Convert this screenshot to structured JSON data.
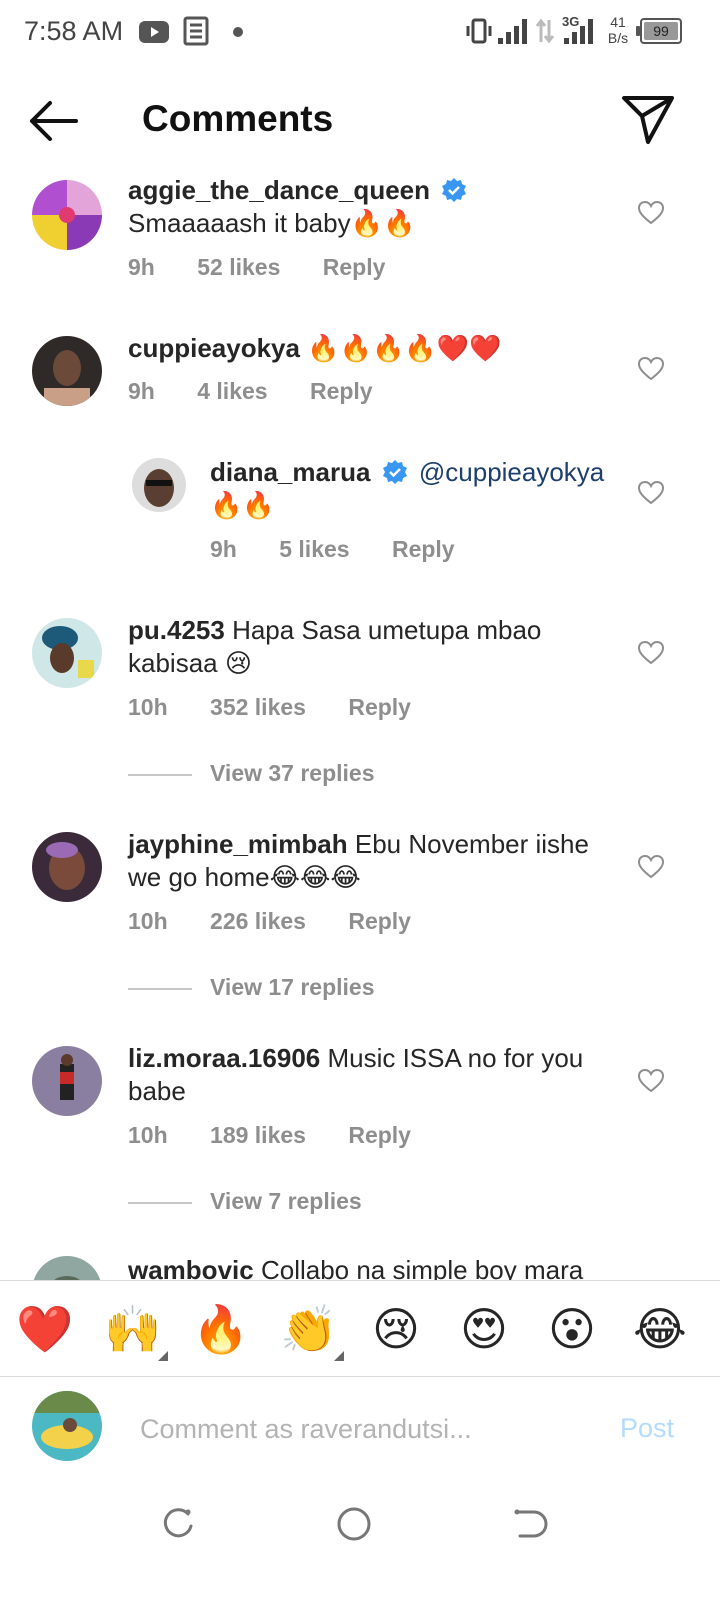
{
  "status_bar": {
    "time": "7:58 AM",
    "net_speed_value": "41",
    "net_speed_unit": "B/s",
    "network_type": "3G",
    "battery": "99",
    "icons": [
      "youtube-icon",
      "news-icon",
      "dot-icon",
      "vibrate-icon",
      "signal-icon",
      "data-arrows-icon",
      "signal-icon",
      "battery-icon"
    ]
  },
  "header": {
    "title": "Comments",
    "back_icon": "arrow-left-icon",
    "share_icon": "send-icon"
  },
  "comments": [
    {
      "username": "aggie_the_dance_queen",
      "verified": true,
      "text": "Smaaaaash it baby🔥🔥",
      "time": "9h",
      "likes": "52 likes",
      "reply": "Reply"
    },
    {
      "username": "cuppieayokya",
      "verified": false,
      "text": "🔥🔥🔥🔥❤️❤️",
      "time": "9h",
      "likes": "4 likes",
      "reply": "Reply"
    },
    {
      "username": "diana_marua",
      "verified": true,
      "mention": "@cuppieayokya",
      "text": "🔥🔥",
      "time": "9h",
      "likes": "5 likes",
      "reply": "Reply",
      "is_reply": true
    },
    {
      "username": "pu.4253",
      "verified": false,
      "text": "Hapa Sasa umetupa mbao kabisaa 😢",
      "time": "10h",
      "likes": "352 likes",
      "reply": "Reply",
      "view_replies": "View 37 replies"
    },
    {
      "username": "jayphine_mimbah",
      "verified": false,
      "text": "Ebu November iishe we go home😂😂😂",
      "time": "10h",
      "likes": "226 likes",
      "reply": "Reply",
      "view_replies": "View 17 replies"
    },
    {
      "username": "liz.moraa.16906",
      "verified": false,
      "text": "Music ISSA no for you babe",
      "time": "10h",
      "likes": "189 likes",
      "reply": "Reply",
      "view_replies": "View 7 replies"
    },
    {
      "username": "wambovic",
      "verified": false,
      "text": "Collabo na simple boy mara"
    }
  ],
  "emoji_bar": [
    "❤️",
    "🙌",
    "🔥",
    "👏",
    "😢",
    "😍",
    "😮",
    "😂"
  ],
  "compose": {
    "placeholder": "Comment as raverandutsi...",
    "post_label": "Post"
  },
  "colors": {
    "accent_blue": "#3897f0",
    "post_disabled": "#b3dbff",
    "muted_text": "#8e8e8e",
    "verified_blue": "#3897f0"
  }
}
